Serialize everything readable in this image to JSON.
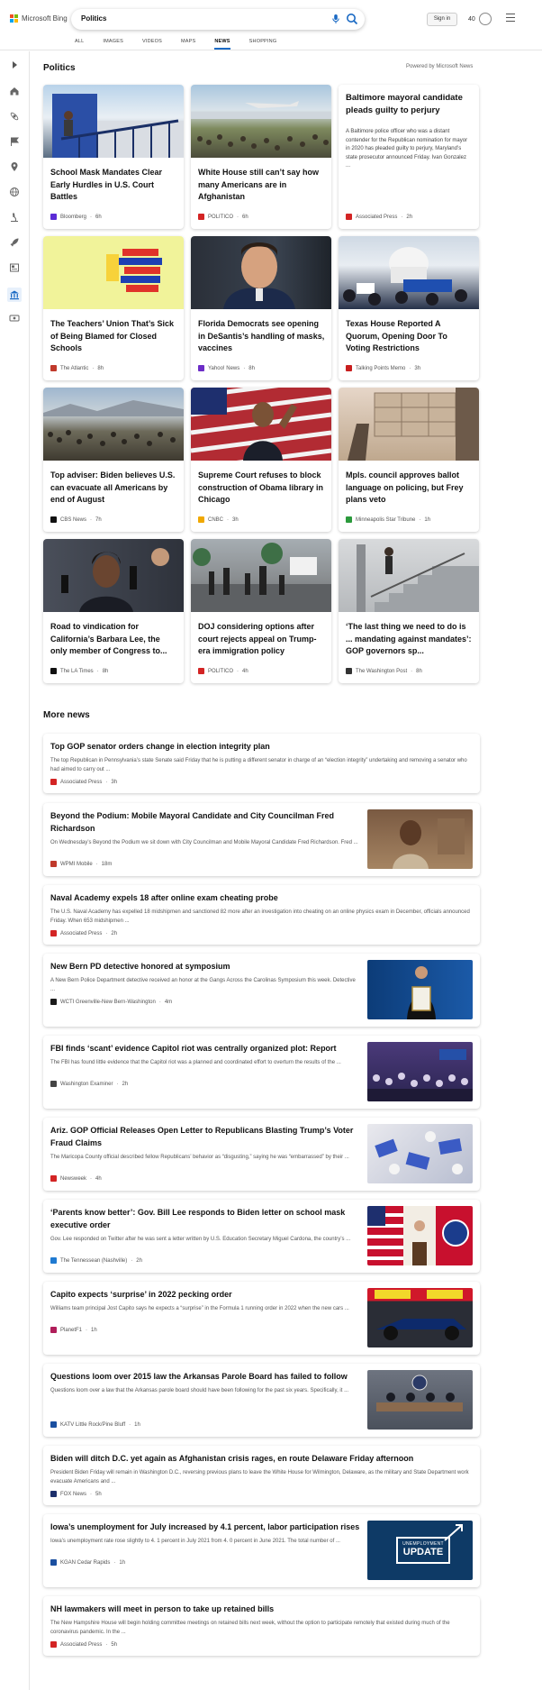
{
  "header": {
    "brand": "Microsoft Bing",
    "search_query": "Politics",
    "signin_label": "Sign in",
    "rewards_count": "40",
    "tabs": [
      {
        "label": "ALL"
      },
      {
        "label": "IMAGES"
      },
      {
        "label": "VIDEOS"
      },
      {
        "label": "MAPS"
      },
      {
        "label": "NEWS"
      },
      {
        "label": "SHOPPING"
      }
    ],
    "active_tab": "NEWS"
  },
  "icons": {
    "mic": "microphone-icon",
    "search": "search-icon",
    "rewards": "rewards-trophy-icon",
    "menu": "hamburger-menu-icon",
    "rail": [
      "expand-icon",
      "home-icon",
      "science-icon",
      "flag-icon",
      "location-icon",
      "globe-icon",
      "microscope-icon",
      "rocket-icon",
      "news-icon",
      "politics-icon",
      "money-icon"
    ]
  },
  "colors": {
    "accent": "#1b6ac4",
    "rail_active_bg": "#e7f0fb"
  },
  "section": {
    "title": "Politics",
    "powered_by": "Powered by Microsoft News"
  },
  "cards": [
    {
      "title": "School Mask Mandates Clear Early Hurdles in U.S. Court Battles",
      "source": "Bloomberg",
      "age": "6h",
      "logo_color": "#5b2bd6"
    },
    {
      "title": "White House still can’t say how many Americans are in Afghanistan",
      "source": "POLITICO",
      "age": "6h",
      "logo_color": "#d32424"
    },
    {
      "title": "Baltimore mayoral candidate pleads guilty to perjury",
      "description": "A Baltimore police officer who was a distant contender for the Republican nomination for mayor in 2020 has pleaded guilty to perjury, Maryland’s state prosecutor announced Friday. Ivan Gonzalez ...",
      "source": "Associated Press",
      "age": "2h",
      "logo_color": "#d32424"
    },
    {
      "title": "The Teachers’ Union That’s Sick of Being Blamed for Closed Schools",
      "source": "The Atlantic",
      "age": "8h",
      "logo_color": "#c0392b"
    },
    {
      "title": "Florida Democrats see opening in DeSantis’s handling of masks, vaccines",
      "source": "Yahoo! News",
      "age": "8h",
      "logo_color": "#6c2dc7"
    },
    {
      "title": "Texas House Reported A Quorum, Opening Door To Voting Restrictions",
      "source": "Talking Points Memo",
      "age": "3h",
      "logo_color": "#c81e1e"
    },
    {
      "title": "Top adviser: Biden believes U.S. can evacuate all Americans by end of August",
      "source": "CBS News",
      "age": "7h",
      "logo_color": "#111111"
    },
    {
      "title": "Supreme Court refuses to block construction of Obama library in Chicago",
      "source": "CNBC",
      "age": "3h",
      "logo_color": "#f0a800"
    },
    {
      "title": "Mpls. council approves ballot language on policing, but Frey plans veto",
      "source": "Minneapolis Star Tribune",
      "age": "1h",
      "logo_color": "#2b9a3c"
    },
    {
      "title": "Road to vindication for California’s Barbara Lee, the only member of Congress to...",
      "source": "The LA Times",
      "age": "8h",
      "logo_color": "#111111"
    },
    {
      "title": "DOJ considering options after court rejects appeal on Trump-era immigration policy",
      "source": "POLITICO",
      "age": "4h",
      "logo_color": "#d32424"
    },
    {
      "title": "‘The last thing we need to do is ... mandating against mandates’: GOP governors sp...",
      "source": "The Washington Post",
      "age": "8h",
      "logo_color": "#333333"
    }
  ],
  "more_news": {
    "title": "More news",
    "items": [
      {
        "title": "Top GOP senator orders change in election integrity plan",
        "description": "The top Republican in Pennsylvania’s state Senate said Friday that he is putting a different senator in charge of an “election integrity” undertaking and removing a senator who had aimed to carry out ...",
        "source": "Associated Press",
        "age": "3h",
        "logo_color": "#d32424",
        "thumb": false
      },
      {
        "title": "Beyond the Podium: Mobile Mayoral Candidate and City Councilman Fred Richardson",
        "description": "On Wednesday’s Beyond the Podium we sit down with City Councilman and Mobile Mayoral Candidate Fred Richardson. Fred ...",
        "source": "WPMI Mobile",
        "age": "18m",
        "logo_color": "#c0392b",
        "thumb": true
      },
      {
        "title": "Naval Academy expels 18 after online exam cheating probe",
        "description": "The U.S. Naval Academy has expelled 18 midshipmen and sanctioned 82 more after an investigation into cheating on an online physics exam in December, officials announced Friday. When 653 midshipmen ...",
        "source": "Associated Press",
        "age": "2h",
        "logo_color": "#d32424",
        "thumb": false
      },
      {
        "title": "New Bern PD detective honored at symposium",
        "description": "A New Bern Police Department detective received an honor at the Gangs Across the Carolinas Symposium this week. Detective ...",
        "source": "WCTI Greenville-New Bern-Washington",
        "age": "4m",
        "logo_color": "#1a1a1a",
        "thumb": true
      },
      {
        "title": "FBI finds ‘scant’ evidence Capitol riot was centrally organized plot: Report",
        "description": "The FBI has found little evidence that the Capitol riot was a planned and coordinated effort to overturn the results of the ...",
        "source": "Washington Examiner",
        "age": "2h",
        "logo_color": "#444444",
        "thumb": true
      },
      {
        "title": "Ariz. GOP Official Releases Open Letter to Republicans Blasting Trump’s Voter Fraud Claims",
        "description": "The Maricopa County official described fellow Republicans’ behavior as “disgusting,” saying he was “embarrassed” by their ...",
        "source": "Newsweek",
        "age": "4h",
        "logo_color": "#d32424",
        "thumb": true
      },
      {
        "title": "‘Parents know better’: Gov. Bill Lee responds to Biden letter on school mask executive order",
        "description": "Gov. Lee responded on Twitter after he was sent a letter written by U.S. Education Secretary Miguel Cardona, the country’s ...",
        "source": "The Tennessean (Nashville)",
        "age": "2h",
        "logo_color": "#1f7ad1",
        "thumb": true
      },
      {
        "title": "Capito expects ‘surprise’ in 2022 pecking order",
        "description": "Williams team principal Jost Capito says he expects a “surprise” in the Formula 1 running order in 2022 when the new cars ...",
        "source": "PlanetF1",
        "age": "1h",
        "logo_color": "#b01e5a",
        "thumb": true
      },
      {
        "title": "Questions loom over 2015 law the Arkansas Parole Board has failed to follow",
        "description": "Questions loom over a law that the Arkansas parole board should have been following for the past six years. Specifically, it ...",
        "source": "KATV Little Rock/Pine Bluff",
        "age": "1h",
        "logo_color": "#1a4fa0",
        "thumb": true
      },
      {
        "title": "Biden will ditch D.C. yet again as Afghanistan crisis rages, en route Delaware Friday afternoon",
        "description": "President Biden Friday will remain in Washington D.C., reversing previous plans to leave the White House for Wilmington, Delaware, as the military and State Department work evacuate Americans and ...",
        "source": "FOX News",
        "age": "5h",
        "logo_color": "#1c2f6b",
        "thumb": false
      },
      {
        "title": "Iowa’s unemployment for July increased by 4.1 percent, labor participation rises",
        "description": "Iowa’s unemployment rate rose slightly to 4. 1 percent in July 2021 from 4. 0 percent in June 2021. The total number of ...",
        "source": "KGAN Cedar Rapids",
        "age": "1h",
        "logo_color": "#1a4fa0",
        "thumb": true,
        "thumb_text_top": "UNEMPLOYMENT",
        "thumb_text_main": "UPDATE"
      },
      {
        "title": "NH lawmakers will meet in person to take up retained bills",
        "description": "The New Hampshire House will begin holding committee meetings on retained bills next week, without the option to participate remotely that existed during much of the coronavirus pandemic. In the ...",
        "source": "Associated Press",
        "age": "5h",
        "logo_color": "#d32424",
        "thumb": false
      }
    ]
  }
}
